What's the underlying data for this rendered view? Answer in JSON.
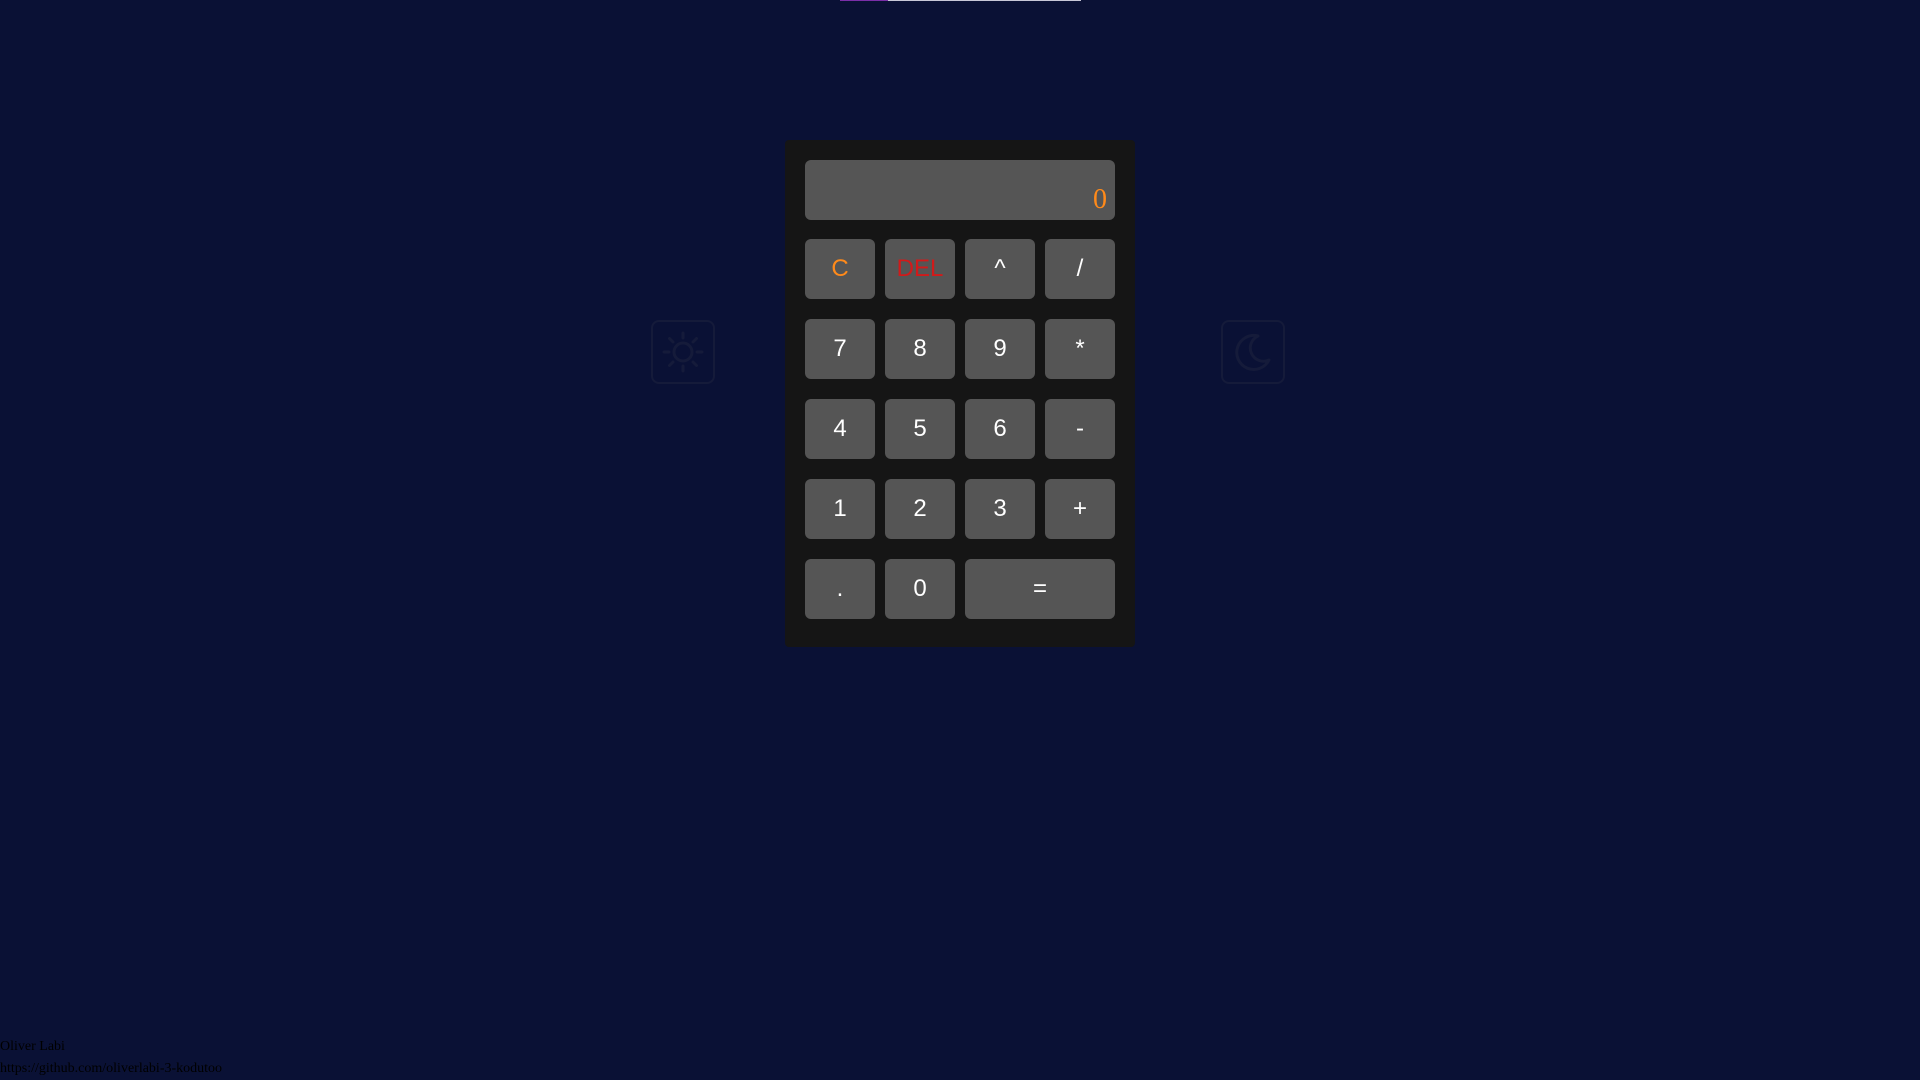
{
  "colors": {
    "background": "#0a1135",
    "calculator_body": "#151515",
    "key_background": "#555555",
    "key_text": "#ffffff",
    "clear_text": "#ff8a1a",
    "del_text": "#d11a1a",
    "display_text": "#ff8a1a"
  },
  "display": {
    "value": "0"
  },
  "keys": {
    "row1": [
      "C",
      "DEL",
      "^",
      "/"
    ],
    "row2": [
      "7",
      "8",
      "9",
      "*"
    ],
    "row3": [
      "4",
      "5",
      "6",
      "-"
    ],
    "row4": [
      "1",
      "2",
      "3",
      "+"
    ],
    "row5": [
      ".",
      "0",
      "="
    ]
  },
  "theme_toggle": {
    "light_icon": "sun-icon",
    "dark_icon": "moon-icon"
  },
  "footer": {
    "author": "Oliver Labi",
    "link": "https://github.com/oliverlabi-3-kodutoo"
  }
}
